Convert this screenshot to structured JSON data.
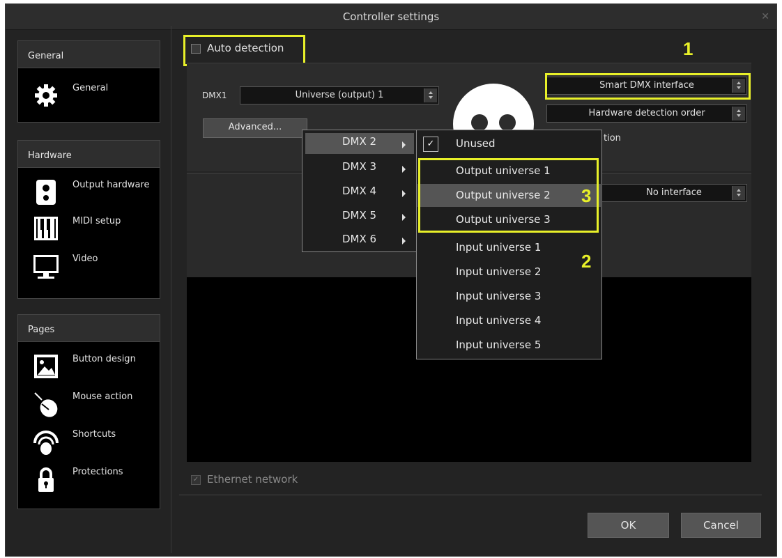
{
  "window": {
    "title": "Controller settings"
  },
  "sidebar": {
    "general": {
      "heading": "General",
      "items": [
        {
          "label": "General",
          "icon": "gear-icon"
        }
      ]
    },
    "hardware": {
      "heading": "Hardware",
      "items": [
        {
          "label": "Output hardware",
          "icon": "speaker-icon"
        },
        {
          "label": "MIDI setup",
          "icon": "piano-icon"
        },
        {
          "label": "Video",
          "icon": "monitor-icon"
        }
      ]
    },
    "pages": {
      "heading": "Pages",
      "items": [
        {
          "label": "Button design",
          "icon": "image-icon"
        },
        {
          "label": "Mouse action",
          "icon": "mouse-icon"
        },
        {
          "label": "Shortcuts",
          "icon": "finger-icon"
        },
        {
          "label": "Protections",
          "icon": "lock-icon"
        }
      ]
    }
  },
  "main": {
    "auto_detection_label": "Auto detection",
    "dmx1_label": "DMX1",
    "dmx1_value": "Universe (output) 1",
    "advanced_label": "Advanced...",
    "interface_value": "Smart DMX interface",
    "detection_order_value": "Hardware detection order",
    "partial_text": "tion",
    "second_interface_value": "No interface",
    "ethernet_label": "Ethernet network",
    "ok_label": "OK",
    "cancel_label": "Cancel"
  },
  "dmx_menu": {
    "items": [
      "DMX 2",
      "DMX 3",
      "DMX 4",
      "DMX 5",
      "DMX 6"
    ],
    "selected": "DMX 2"
  },
  "universe_menu": {
    "items": [
      "Unused",
      "Output universe 1",
      "Output universe 2",
      "Output universe 3",
      "Input universe 1",
      "Input universe 2",
      "Input universe 3",
      "Input universe 4",
      "Input universe 5"
    ],
    "checked": "Unused",
    "hovered": "Output universe 2"
  },
  "annotations": {
    "a1": "1",
    "a2": "2",
    "a3": "3"
  },
  "colors": {
    "highlight": "#e8f029",
    "background": "#232323",
    "panel": "#000000"
  }
}
